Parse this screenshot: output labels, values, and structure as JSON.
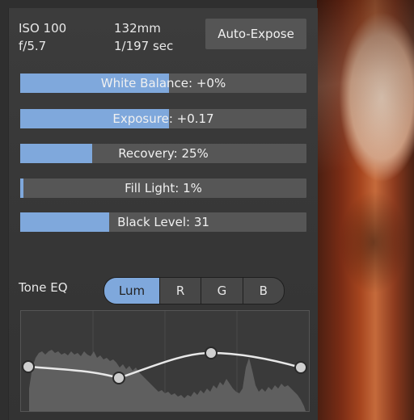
{
  "info": {
    "iso": "ISO 100",
    "focal_length": "132mm",
    "aperture": "f/5.7",
    "shutter": "1/197 sec"
  },
  "auto_expose_label": "Auto-Expose",
  "sliders": [
    {
      "label": "White Balance: +0%",
      "fill": 0.52
    },
    {
      "label": "Exposure: +0.17",
      "fill": 0.52
    },
    {
      "label": "Recovery: 25%",
      "fill": 0.25
    },
    {
      "label": "Fill Light: 1%",
      "fill": 0.01
    },
    {
      "label": "Black Level: 31",
      "fill": 0.31
    }
  ],
  "tone_eq": {
    "label": "Tone EQ",
    "modes": [
      "Lum",
      "R",
      "G",
      "B"
    ],
    "active_mode": "Lum"
  },
  "colors": {
    "accent": "#7fa8dc",
    "panel": "#3a3a3a",
    "slider_track": "#565656"
  }
}
